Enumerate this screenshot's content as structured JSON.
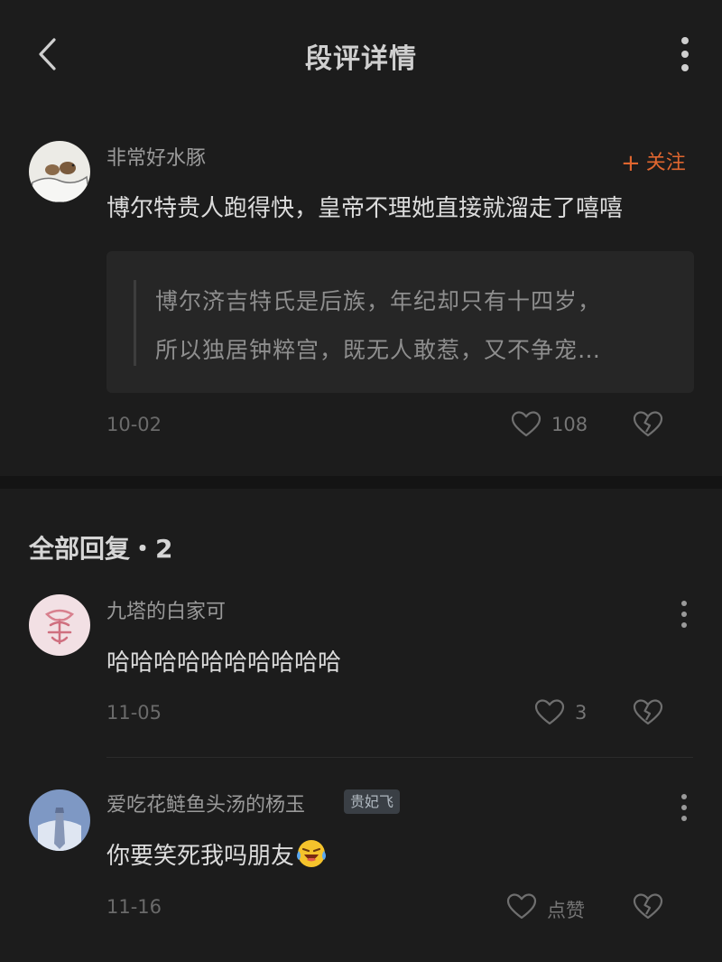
{
  "header": {
    "title": "段评详情"
  },
  "post": {
    "username": "非常好水豚",
    "follow_label": "关注",
    "text": "博尔特贵人跑得快，皇帝不理她直接就溜走了嘻嘻",
    "quote_lines": [
      "博尔济吉特氏是后族，年纪却只有十四岁，",
      "所以独居钟粹宫，既无人敢惹，又不争宠…"
    ],
    "date": "10-02",
    "likes": "108"
  },
  "replies": {
    "header": "全部回复・2",
    "items": [
      {
        "username": "九塔的白家可",
        "text": "哈哈哈哈哈哈哈哈哈哈",
        "date": "11-05",
        "likes": "3"
      },
      {
        "username": "爱吃花鲢鱼头汤的杨玉",
        "badge": "贵妃飞",
        "text": "你要笑死我吗朋友",
        "emoji": "laughing-crying-emoji",
        "date": "11-16",
        "likes": "点赞"
      }
    ]
  },
  "colors": {
    "background": "#1c1c1c",
    "accent": "#e0662f",
    "quote_bg": "#262626"
  }
}
